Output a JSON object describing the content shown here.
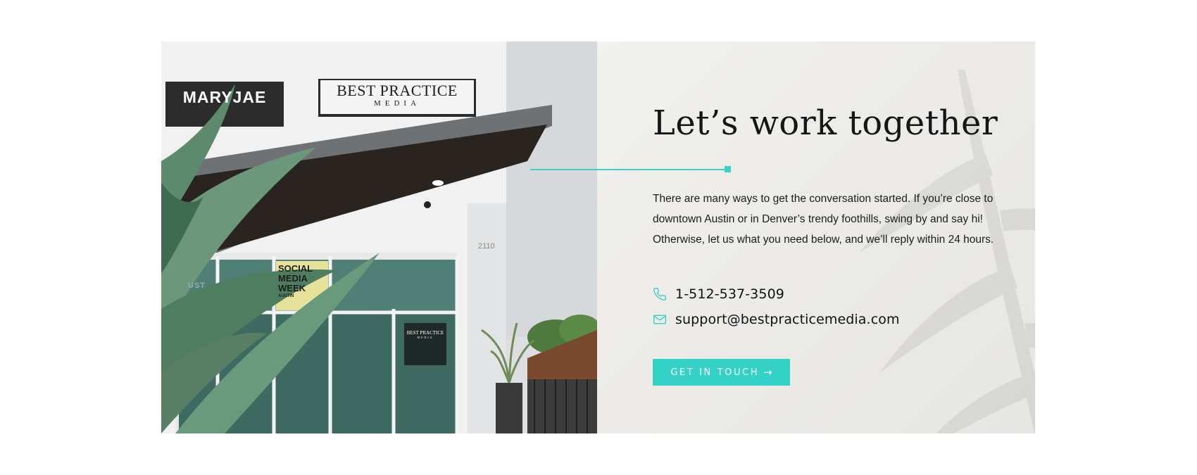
{
  "photo": {
    "sign_left": "MARYJAE",
    "sign_right_line1": "BEST PRACTICE",
    "sign_right_line2": "MEDIA",
    "address_number": "2110",
    "window_poster_line1": "SOCIAL",
    "window_poster_line2": "MEDIA",
    "window_poster_line3": "WEEK",
    "window_poster_line4": "AUSTIN",
    "window_fragment": "UST",
    "door_sign_line1": "BEST PRACTICE",
    "door_sign_line2": "MEDIA"
  },
  "contact": {
    "headline": "Let’s work together",
    "description": "There are many ways to get the conversation started. If you’re close to downtown Austin or in Denver’s trendy foothills, swing by and say hi! Otherwise, let us what you need below, and we’ll reply within 24 hours.",
    "phone": "1-512-537-3509",
    "email": "support@bestpracticemedia.com",
    "cta_label": "GET IN TOUCH",
    "cta_arrow": "→",
    "phone_icon": "phone-icon",
    "email_icon": "mail-icon"
  },
  "colors": {
    "accent": "#33d1c6",
    "text": "#161616",
    "panel_bg": "#ecebe8"
  }
}
